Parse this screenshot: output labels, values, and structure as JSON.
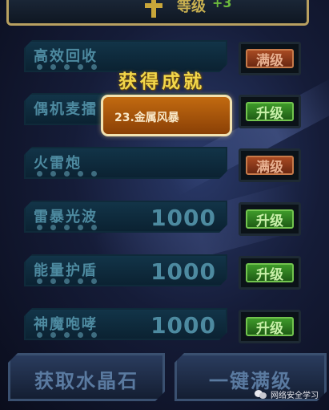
{
  "header": {
    "level_label": "等级",
    "level_bonus": "+3"
  },
  "skills": [
    {
      "name": "高效回收",
      "value": "",
      "dots": 5,
      "button": "满级",
      "button_type": "max"
    },
    {
      "name": "偶机麦擂",
      "value": "",
      "dots": 0,
      "button": "升级",
      "button_type": "up"
    },
    {
      "name": "火雷炮",
      "value": "",
      "dots": 5,
      "button": "满级",
      "button_type": "max"
    },
    {
      "name": "雷暴光波",
      "value": "1000",
      "dots": 5,
      "button": "升级",
      "button_type": "up"
    },
    {
      "name": "能量护盾",
      "value": "1000",
      "dots": 5,
      "button": "升级",
      "button_type": "up"
    },
    {
      "name": "神魔咆哮",
      "value": "1000",
      "dots": 5,
      "button": "升级",
      "button_type": "up"
    }
  ],
  "achievement": {
    "title": "获得成就",
    "item": "23.金属风暴"
  },
  "bottom": {
    "crystal_label": "获取水晶石",
    "max_all_label": "一键满级"
  },
  "watermark": {
    "text": "网络安全学习"
  },
  "colors": {
    "max_button": "#a84a22",
    "up_button": "#3e9a2a",
    "achievement_box": "#c26a10",
    "achievement_title": "#f2d64a"
  }
}
